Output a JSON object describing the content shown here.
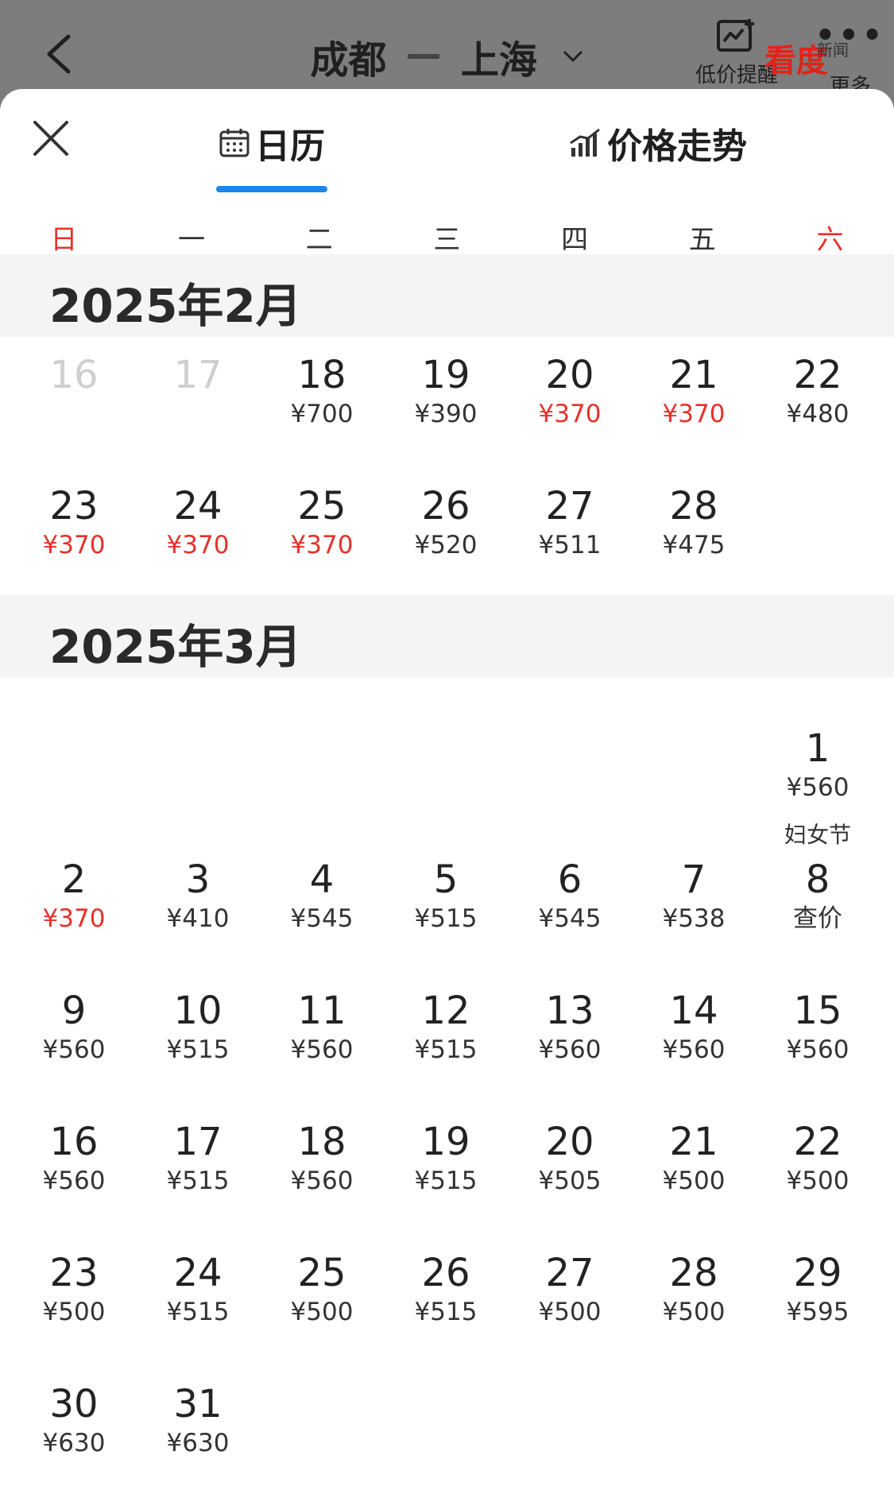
{
  "header": {
    "origin": "成都",
    "destination": "上海",
    "alert_label": "低价提醒",
    "more_label": "更多",
    "watermark": "看度",
    "watermark_sub": "新闻"
  },
  "sheet": {
    "tabs": [
      {
        "label": "日历"
      },
      {
        "label": "价格走势"
      }
    ],
    "weekdays": [
      "日",
      "一",
      "二",
      "三",
      "四",
      "五",
      "六"
    ]
  },
  "months": [
    {
      "title": "2025年2月",
      "rows": [
        [
          {
            "day": "16",
            "price": "",
            "dim": true
          },
          {
            "day": "17",
            "price": "",
            "dim": true
          },
          {
            "day": "18",
            "price": "¥700"
          },
          {
            "day": "19",
            "price": "¥390"
          },
          {
            "day": "20",
            "price": "¥370",
            "low": true
          },
          {
            "day": "21",
            "price": "¥370",
            "low": true
          },
          {
            "day": "22",
            "price": "¥480"
          }
        ],
        [
          {
            "day": "23",
            "price": "¥370",
            "low": true
          },
          {
            "day": "24",
            "price": "¥370",
            "low": true
          },
          {
            "day": "25",
            "price": "¥370",
            "low": true
          },
          {
            "day": "26",
            "price": "¥520"
          },
          {
            "day": "27",
            "price": "¥511"
          },
          {
            "day": "28",
            "price": "¥475"
          },
          null
        ]
      ]
    },
    {
      "title": "2025年3月",
      "rows": [
        [
          null,
          null,
          null,
          null,
          null,
          null,
          {
            "day": "1",
            "price": "¥560"
          }
        ],
        [
          {
            "day": "2",
            "price": "¥370",
            "low": true
          },
          {
            "day": "3",
            "price": "¥410"
          },
          {
            "day": "4",
            "price": "¥545"
          },
          {
            "day": "5",
            "price": "¥515"
          },
          {
            "day": "6",
            "price": "¥545"
          },
          {
            "day": "7",
            "price": "¥538"
          },
          {
            "day": "8",
            "price": "查价",
            "holiday": "妇女节"
          }
        ],
        [
          {
            "day": "9",
            "price": "¥560"
          },
          {
            "day": "10",
            "price": "¥515"
          },
          {
            "day": "11",
            "price": "¥560"
          },
          {
            "day": "12",
            "price": "¥515"
          },
          {
            "day": "13",
            "price": "¥560"
          },
          {
            "day": "14",
            "price": "¥560"
          },
          {
            "day": "15",
            "price": "¥560"
          }
        ],
        [
          {
            "day": "16",
            "price": "¥560"
          },
          {
            "day": "17",
            "price": "¥515"
          },
          {
            "day": "18",
            "price": "¥560"
          },
          {
            "day": "19",
            "price": "¥515"
          },
          {
            "day": "20",
            "price": "¥505"
          },
          {
            "day": "21",
            "price": "¥500"
          },
          {
            "day": "22",
            "price": "¥500"
          }
        ],
        [
          {
            "day": "23",
            "price": "¥500"
          },
          {
            "day": "24",
            "price": "¥515"
          },
          {
            "day": "25",
            "price": "¥500"
          },
          {
            "day": "26",
            "price": "¥515"
          },
          {
            "day": "27",
            "price": "¥500"
          },
          {
            "day": "28",
            "price": "¥500"
          },
          {
            "day": "29",
            "price": "¥595"
          }
        ],
        [
          {
            "day": "30",
            "price": "¥630"
          },
          {
            "day": "31",
            "price": "¥630"
          },
          null,
          null,
          null,
          null,
          null
        ]
      ]
    }
  ],
  "colors": {
    "accent": "#1a86f0",
    "low_price": "#e6312a",
    "month_band": "#f4f4f4"
  }
}
